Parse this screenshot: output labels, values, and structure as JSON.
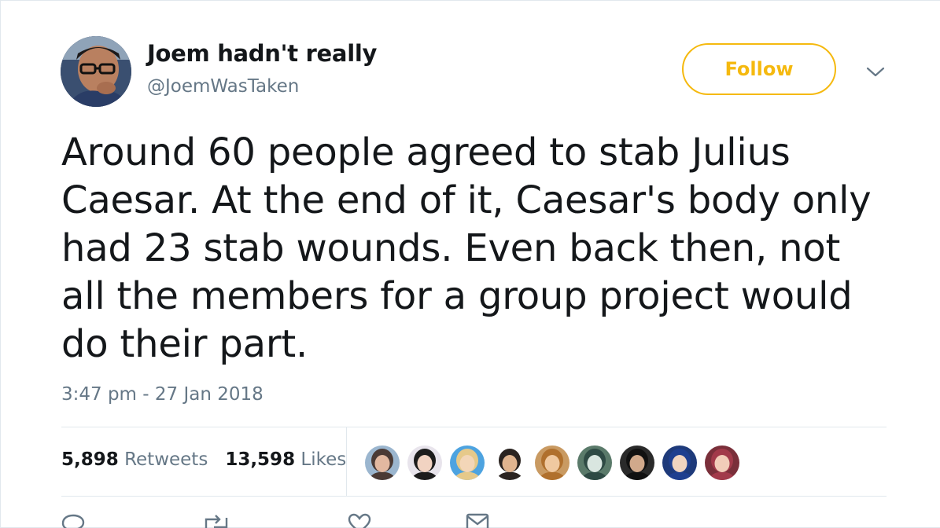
{
  "author": {
    "display_name": "Joem hadn't really",
    "screen_name": "@JoemWasTaken"
  },
  "follow_label": "Follow",
  "tweet": {
    "text": "Around 60 people agreed to stab Julius Caesar. At the end of it, Caesar's body only had 23 stab wounds. Even back then, not all the members for a group project would do their part.",
    "timestamp": "3:47 pm - 27 Jan 2018"
  },
  "stats": {
    "retweets_count": "5,898",
    "retweets_label": "Retweets",
    "likes_count": "13,598",
    "likes_label": "Likes"
  },
  "likers": [
    {
      "name": "liker-1",
      "bg": "#9bb6cf",
      "skin": "#e2b8a0",
      "hair": "#4a3a35"
    },
    {
      "name": "liker-2",
      "bg": "#e8e4ec",
      "skin": "#f1d3c2",
      "hair": "#1c1c1c"
    },
    {
      "name": "liker-3",
      "bg": "#4da3e0",
      "skin": "#f3d6b8",
      "hair": "#e6c98a"
    },
    {
      "name": "liker-4",
      "bg": "#ffffff",
      "skin": "#e0b48f",
      "hair": "#2a2320"
    },
    {
      "name": "liker-5",
      "bg": "#c99a62",
      "skin": "#f0c9a0",
      "hair": "#b0702d"
    },
    {
      "name": "liker-6",
      "bg": "#5a7a6a",
      "skin": "#d9e6e0",
      "hair": "#2e4a44"
    },
    {
      "name": "liker-7",
      "bg": "#2a2a2a",
      "skin": "#d1a98b",
      "hair": "#111111"
    },
    {
      "name": "liker-8",
      "bg": "#1e3a7a",
      "skin": "#f1d5c0",
      "hair": "#1f3f8f"
    },
    {
      "name": "liker-9",
      "bg": "#7a2f3a",
      "skin": "#f2cdb9",
      "hair": "#a23a4a"
    }
  ],
  "colors": {
    "accent": "#f5b90f",
    "secondary_text": "#657786",
    "primary_text": "#14171a",
    "divider": "#e1e8ed"
  }
}
